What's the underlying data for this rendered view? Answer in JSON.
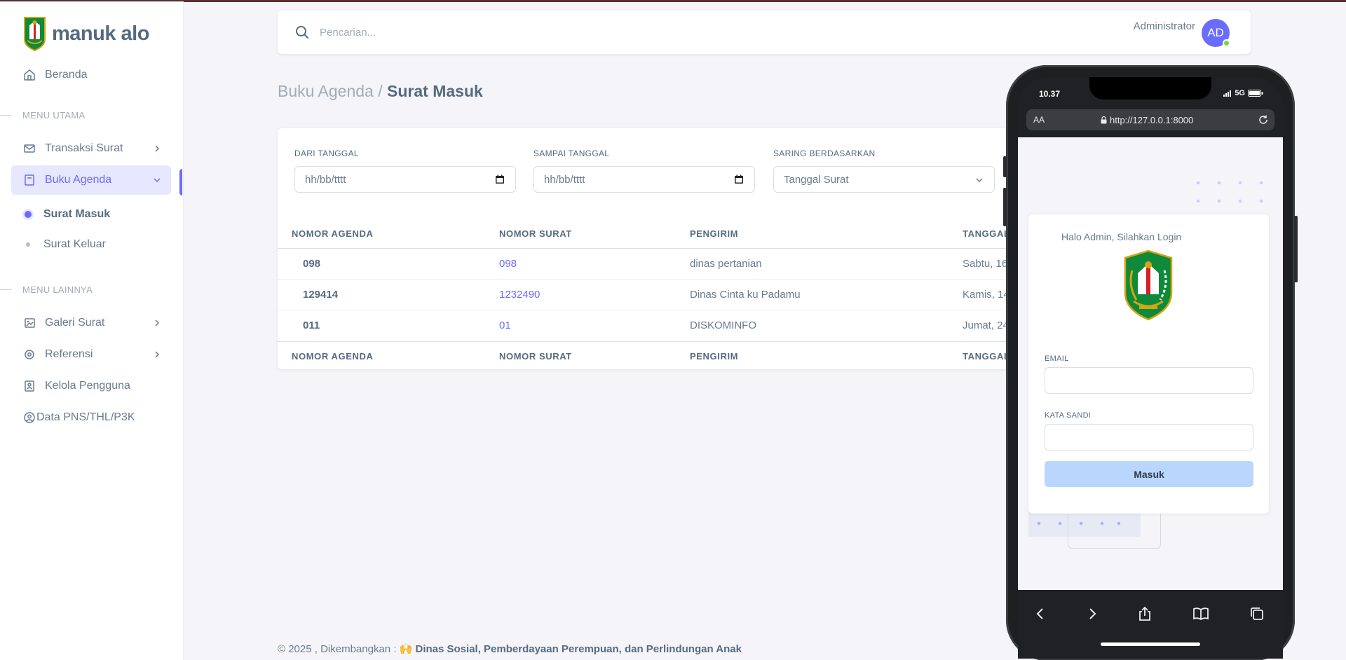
{
  "brand": {
    "name": "manuk alo"
  },
  "sidebar": {
    "home": "Beranda",
    "section_main": "MENU UTAMA",
    "transaksi": "Transaksi Surat",
    "agenda": "Buku Agenda",
    "sub_masuk": "Surat Masuk",
    "sub_keluar": "Surat Keluar",
    "section_other": "MENU LAINNYA",
    "galeri": "Galeri Surat",
    "referensi": "Referensi",
    "kelola": "Kelola Pengguna",
    "pns": "Data PNS/THL/P3K"
  },
  "navbar": {
    "search_placeholder": "Pencarian...",
    "user": "Administrator",
    "avatar": "AD"
  },
  "breadcrumb": {
    "parent": "Buku Agenda /",
    "current": "Surat Masuk"
  },
  "filters": {
    "from_label": "DARI TANGGAL",
    "from_value": "hh/bb/tttt",
    "to_label": "SAMPAI TANGGAL",
    "to_value": "hh/bb/tttt",
    "filter_label": "SARING BERDASARKAN",
    "filter_value": "Tanggal Surat"
  },
  "table": {
    "headers": [
      "NOMOR AGENDA",
      "NOMOR SURAT",
      "PENGIRIM",
      "TANGGAL"
    ],
    "rows": [
      {
        "agenda": "098",
        "nomor": "098",
        "pengirim": "dinas pertanian",
        "tanggal": "Sabtu, 16"
      },
      {
        "agenda": "129414",
        "nomor": "1232490",
        "pengirim": "Dinas Cinta ku Padamu",
        "tanggal": "Kamis, 14"
      },
      {
        "agenda": "011",
        "nomor": "01",
        "pengirim": "DISKOMINFO",
        "tanggal": "Jumat, 24"
      }
    ]
  },
  "footer": {
    "prefix": "© 2025 , Dikembangkan : 🙌 ",
    "org": "Dinas Sosial, Pemberdayaan Perempuan, dan Perlindungan Anak"
  },
  "phone": {
    "time": "10.37",
    "network": "5G",
    "url_aa": "AA",
    "url": "http://127.0.0.1:8000",
    "login_hello": "Halo Admin, Silahkan Login",
    "email_label": "EMAIL",
    "password_label": "KATA SANDI",
    "submit": "Masuk"
  },
  "colors": {
    "accent": "#696cff",
    "online": "#71dd37",
    "login_button": "#b9d7fd"
  }
}
